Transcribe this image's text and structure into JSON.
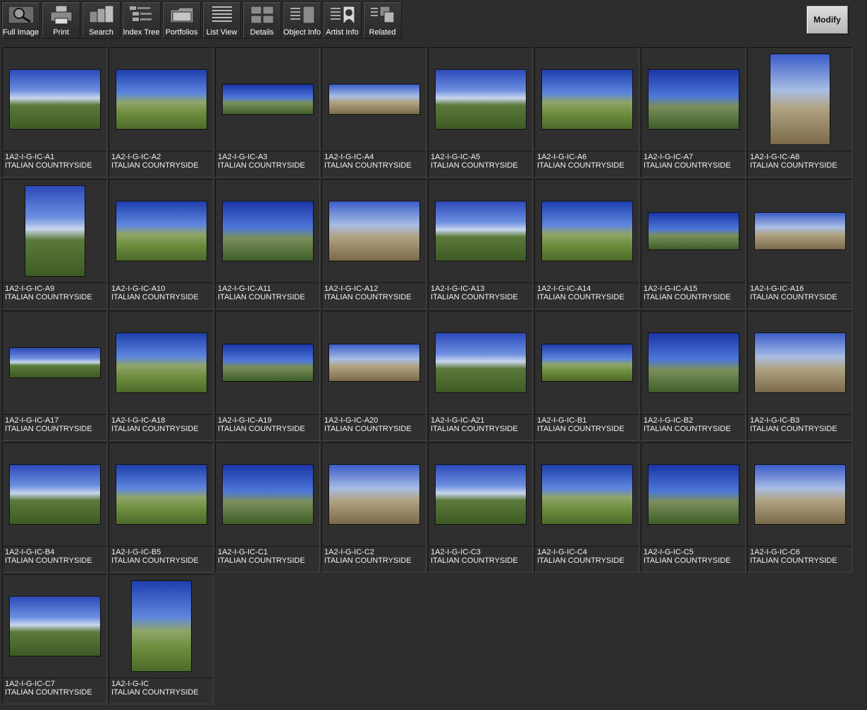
{
  "toolbar": {
    "items": [
      {
        "label": "Full Image",
        "icon": "magnifier-icon"
      },
      {
        "label": "Print",
        "icon": "printer-icon"
      },
      {
        "label": "Search",
        "icon": "search-icon"
      },
      {
        "label": "Index Tree",
        "icon": "index-tree-icon"
      },
      {
        "label": "Portfolios",
        "icon": "portfolios-icon"
      },
      {
        "label": "List View",
        "icon": "list-view-icon"
      },
      {
        "label": "Details",
        "icon": "details-icon"
      },
      {
        "label": "Object Info",
        "icon": "object-info-icon"
      },
      {
        "label": "Artist  Info",
        "icon": "artist-info-icon"
      },
      {
        "label": "Related",
        "icon": "related-icon"
      }
    ],
    "modify_label": "Modify"
  },
  "thumbnails": [
    {
      "id": "1A2-I-G-IC-A1",
      "title": "ITALIAN COUNTRYSIDE",
      "orientation": "landscape"
    },
    {
      "id": "1A2-I-G-IC-A2",
      "title": "ITALIAN COUNTRYSIDE",
      "orientation": "landscape"
    },
    {
      "id": "1A2-I-G-IC-A3",
      "title": "ITALIAN COUNTRYSIDE",
      "orientation": "panorama"
    },
    {
      "id": "1A2-I-G-IC-A4",
      "title": "ITALIAN COUNTRYSIDE",
      "orientation": "panorama"
    },
    {
      "id": "1A2-I-G-IC-A5",
      "title": "ITALIAN COUNTRYSIDE",
      "orientation": "landscape"
    },
    {
      "id": "1A2-I-G-IC-A6",
      "title": "ITALIAN COUNTRYSIDE",
      "orientation": "landscape"
    },
    {
      "id": "1A2-I-G-IC-A7",
      "title": "ITALIAN COUNTRYSIDE",
      "orientation": "landscape"
    },
    {
      "id": "1A2-I-G-IC-A8",
      "title": "ITALIAN COUNTRYSIDE",
      "orientation": "portrait"
    },
    {
      "id": "1A2-I-G-IC-A9",
      "title": "ITALIAN COUNTRYSIDE",
      "orientation": "portrait"
    },
    {
      "id": "1A2-I-G-IC-A10",
      "title": "ITALIAN COUNTRYSIDE",
      "orientation": "landscape"
    },
    {
      "id": "1A2-I-G-IC-A11",
      "title": "ITALIAN COUNTRYSIDE",
      "orientation": "landscape"
    },
    {
      "id": "1A2-I-G-IC-A12",
      "title": "ITALIAN COUNTRYSIDE",
      "orientation": "landscape"
    },
    {
      "id": "1A2-I-G-IC-A13",
      "title": "ITALIAN COUNTRYSIDE",
      "orientation": "landscape"
    },
    {
      "id": "1A2-I-G-IC-A14",
      "title": "ITALIAN COUNTRYSIDE",
      "orientation": "landscape"
    },
    {
      "id": "1A2-I-G-IC-A15",
      "title": "ITALIAN COUNTRYSIDE",
      "orientation": "wide"
    },
    {
      "id": "1A2-I-G-IC-A16",
      "title": "ITALIAN COUNTRYSIDE",
      "orientation": "wide"
    },
    {
      "id": "1A2-I-G-IC-A17",
      "title": "ITALIAN COUNTRYSIDE",
      "orientation": "panorama"
    },
    {
      "id": "1A2-I-G-IC-A18",
      "title": "ITALIAN COUNTRYSIDE",
      "orientation": "landscape"
    },
    {
      "id": "1A2-I-G-IC-A19",
      "title": "ITALIAN COUNTRYSIDE",
      "orientation": "wide"
    },
    {
      "id": "1A2-I-G-IC-A20",
      "title": "ITALIAN COUNTRYSIDE",
      "orientation": "wide"
    },
    {
      "id": "1A2-I-G-IC-A21",
      "title": "ITALIAN COUNTRYSIDE",
      "orientation": "landscape"
    },
    {
      "id": "1A2-I-G-IC-B1",
      "title": "ITALIAN COUNTRYSIDE",
      "orientation": "wide"
    },
    {
      "id": "1A2-I-G-IC-B2",
      "title": "ITALIAN COUNTRYSIDE",
      "orientation": "landscape"
    },
    {
      "id": "1A2-I-G-IC-B3",
      "title": "ITALIAN COUNTRYSIDE",
      "orientation": "landscape"
    },
    {
      "id": "1A2-I-G-IC-B4",
      "title": "ITALIAN COUNTRYSIDE",
      "orientation": "landscape"
    },
    {
      "id": "1A2-I-G-IC-B5",
      "title": "ITALIAN COUNTRYSIDE",
      "orientation": "landscape"
    },
    {
      "id": "1A2-I-G-IC-C1",
      "title": "ITALIAN COUNTRYSIDE",
      "orientation": "landscape"
    },
    {
      "id": "1A2-I-G-IC-C2",
      "title": "ITALIAN COUNTRYSIDE",
      "orientation": "landscape"
    },
    {
      "id": "1A2-I-G-IC-C3",
      "title": "ITALIAN COUNTRYSIDE",
      "orientation": "landscape"
    },
    {
      "id": "1A2-I-G-IC-C4",
      "title": "ITALIAN COUNTRYSIDE",
      "orientation": "landscape"
    },
    {
      "id": "1A2-I-G-IC-C5",
      "title": "ITALIAN COUNTRYSIDE",
      "orientation": "landscape"
    },
    {
      "id": "1A2-I-G-IC-C6",
      "title": "ITALIAN COUNTRYSIDE",
      "orientation": "landscape"
    },
    {
      "id": "1A2-I-G-IC-C7",
      "title": "ITALIAN COUNTRYSIDE",
      "orientation": "landscape"
    },
    {
      "id": "1A2-I-G-IC",
      "title": "ITALIAN COUNTRYSIDE",
      "orientation": "portrait"
    }
  ]
}
